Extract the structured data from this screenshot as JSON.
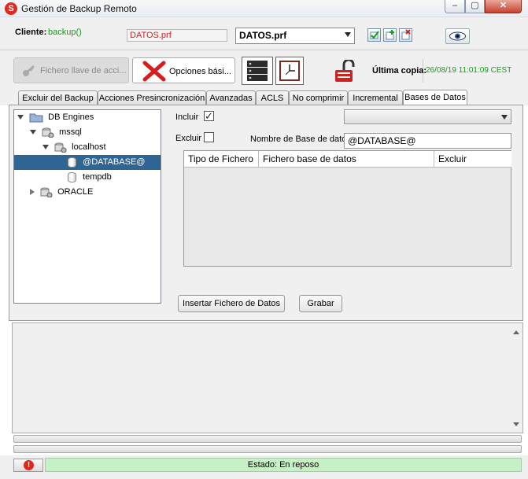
{
  "window": {
    "title": "Gestión de Backup Remoto",
    "min": "–",
    "max": "▢",
    "close": "✕"
  },
  "client": {
    "label": "Cliente:",
    "value": "backup()",
    "prf_file": "DATOS.prf",
    "profile_selected": "DATOS.prf"
  },
  "toolbar": {
    "key_button": "Fichero llave de acci...",
    "options_button": "Opciones bási...",
    "last_copy_label": "Última copia:",
    "last_copy_value": "26/08/19 11:01:09 CEST"
  },
  "tabs": [
    {
      "label": "Excluir del Backup"
    },
    {
      "label": "Acciones Presincronización"
    },
    {
      "label": "Avanzadas"
    },
    {
      "label": "ACLS"
    },
    {
      "label": "No comprimir"
    },
    {
      "label": "Incremental"
    },
    {
      "label": "Bases de Datos"
    }
  ],
  "tree": {
    "nodes": [
      {
        "label": "DB Engines"
      },
      {
        "label": "mssql"
      },
      {
        "label": "localhost"
      },
      {
        "label": "@DATABASE@"
      },
      {
        "label": "tempdb"
      },
      {
        "label": "ORACLE"
      }
    ]
  },
  "form": {
    "include_label": "Incluir",
    "include_checked": "✓",
    "exclude_label": "Excluir",
    "dbname_label": "Nombre de Base de datos",
    "dbname_value": "@DATABASE@",
    "combo_value": ""
  },
  "grid": {
    "columns": [
      "Tipo de Fichero",
      "Fichero base de datos",
      "Excluir"
    ]
  },
  "buttons": {
    "insert": "Insertar Fichero de Datos",
    "save": "Grabar"
  },
  "status": {
    "text": "Estado: En reposo",
    "icon": "!"
  },
  "colors": {
    "selected": "#2f6592",
    "status_bg": "#c6f0c6",
    "accent_green": "#1a9a1a",
    "accent_red": "#d02020"
  }
}
